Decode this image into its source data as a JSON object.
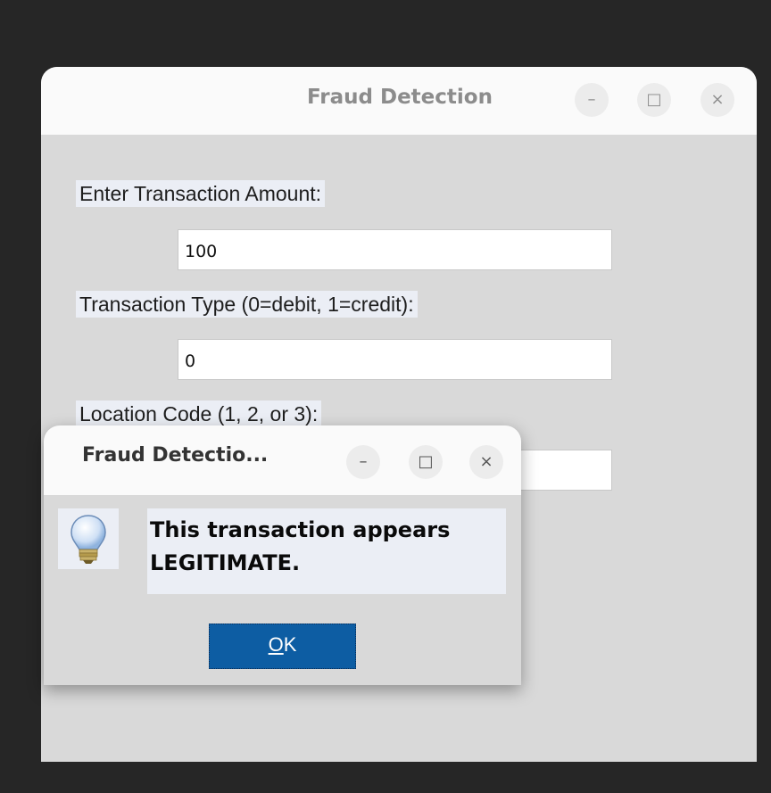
{
  "main_window": {
    "title": "Fraud Detection",
    "fields": [
      {
        "label": "Enter Transaction Amount:",
        "value": "100"
      },
      {
        "label": "Transaction Type (0=debit, 1=credit):",
        "value": "0"
      },
      {
        "label": "Location Code (1, 2, or 3):",
        "value": ""
      }
    ]
  },
  "dialog": {
    "title": "Fraud Detectio...",
    "message_line1": "This transaction appears",
    "message_line2": "LEGITIMATE.",
    "ok_label_first": "O",
    "ok_label_rest": "K",
    "icon": "lightbulb-icon"
  },
  "window_controls": {
    "minimize": "–",
    "maximize": "□",
    "close": "×"
  }
}
